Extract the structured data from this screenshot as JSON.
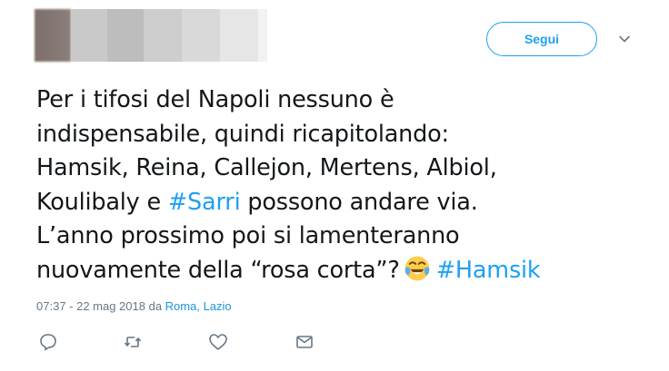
{
  "header": {
    "follow_label": "Segui"
  },
  "tweet": {
    "line1": "Per i tifosi del Napoli nessuno è",
    "line2": "indispensabile, quindi ricapitolando:",
    "line3": "Hamsik, Reina, Callejon, Mertens, Albiol,",
    "line4_pre": "Koulibaly e ",
    "hashtag1": "#Sarri",
    "line4_post": " possono andare via.",
    "line5": "L’anno prossimo poi si lamenteranno",
    "line6": "nuovamente della “rosa corta”?",
    "emoji": "face-with-tears-of-joy",
    "hashtag2": "#Hamsik"
  },
  "meta": {
    "time_date": "07:37 - 22 mag 2018 da ",
    "location": "Roma, Lazio"
  },
  "icons": {
    "reply": "reply-icon",
    "retweet": "retweet-icon",
    "like": "heart-icon",
    "message": "direct-message-icon"
  },
  "colors": {
    "accent": "#1da1f2",
    "meta_text": "#657786",
    "body_text": "#14171a"
  }
}
